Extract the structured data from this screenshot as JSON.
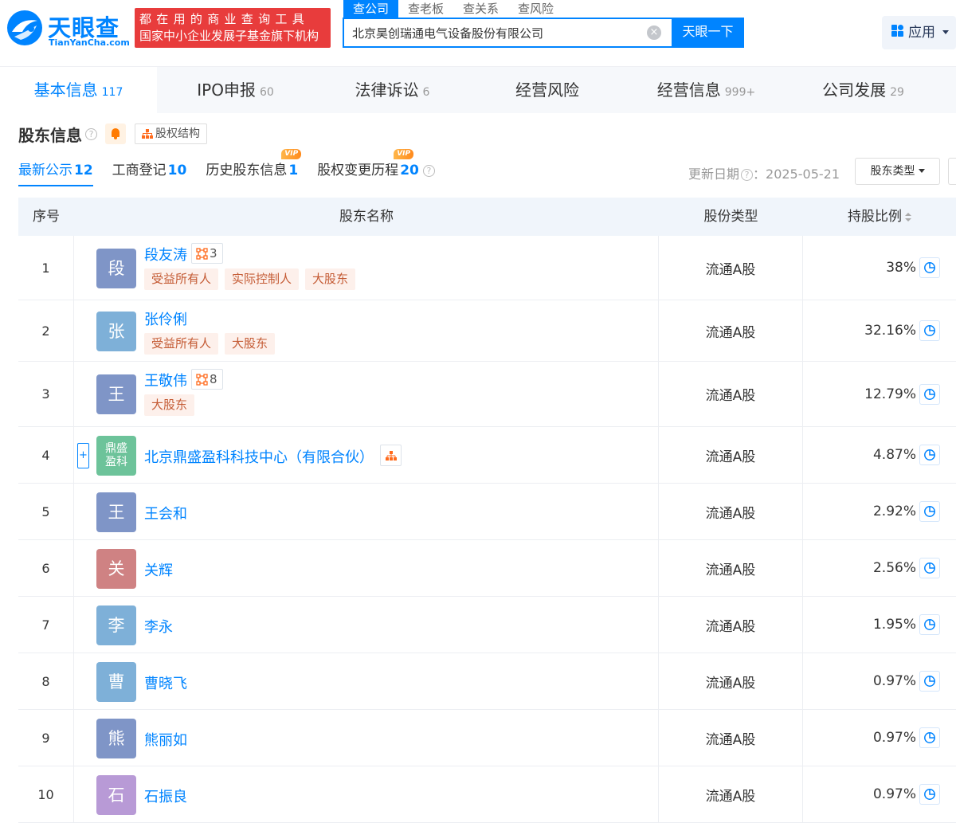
{
  "header": {
    "logo_cn": "天眼查",
    "logo_en": "TianYanCha.com",
    "slogan_line1": "都在用的商业查询工具",
    "slogan_line2": "国家中小企业发展子基金旗下机构",
    "search_tabs": [
      "查公司",
      "查老板",
      "查关系",
      "查风险"
    ],
    "search_value": "北京昊创瑞通电气设备股份有限公司",
    "search_button": "天眼一下",
    "apps_label": "应用"
  },
  "main_tabs": [
    {
      "label": "基本信息",
      "count": "117"
    },
    {
      "label": "IPO申报",
      "count": "60"
    },
    {
      "label": "法律诉讼",
      "count": "6"
    },
    {
      "label": "经营风险",
      "count": ""
    },
    {
      "label": "经营信息",
      "count": "999+"
    },
    {
      "label": "公司发展",
      "count": "29"
    }
  ],
  "section": {
    "title": "股东信息",
    "help": "?",
    "equity_button": "股权结构"
  },
  "sub_tabs": [
    {
      "label": "最新公示",
      "count": "12",
      "vip": ""
    },
    {
      "label": "工商登记",
      "count": "10",
      "vip": ""
    },
    {
      "label": "历史股东信息",
      "count": "1",
      "vip": "VIP"
    },
    {
      "label": "股权变更历程",
      "count": "20",
      "vip": "VIP"
    }
  ],
  "update_label": "更新日期",
  "update_date": "：2025-05-21",
  "type_dropdown": "股东类型",
  "table": {
    "headers": {
      "index": "序号",
      "name": "股东名称",
      "type": "股份类型",
      "ratio": "持股比例"
    },
    "rows": [
      {
        "index": "1",
        "avatar": "段",
        "avatar_color": "#7f95c7",
        "name": "段友涛",
        "rel_count": "3",
        "tags": [
          "受益所有人",
          "实际控制人",
          "大股东"
        ],
        "type": "流通A股",
        "ratio": "38%"
      },
      {
        "index": "2",
        "avatar": "张",
        "avatar_color": "#7eb0d8",
        "name": "张伶俐",
        "rel_count": "",
        "tags": [
          "受益所有人",
          "大股东"
        ],
        "type": "流通A股",
        "ratio": "32.16%"
      },
      {
        "index": "3",
        "avatar": "王",
        "avatar_color": "#7f95c7",
        "name": "王敬伟",
        "rel_count": "8",
        "tags": [
          "大股东"
        ],
        "type": "流通A股",
        "ratio": "12.79%"
      },
      {
        "index": "4",
        "avatar": "鼎盛盈科",
        "avatar_line1": "鼎盛",
        "avatar_line2": "盈科",
        "avatar_color": "#6dc39a",
        "name": "北京鼎盛盈科科技中心（有限合伙）",
        "expand": "+",
        "rel_count": "",
        "tags": [],
        "type": "流通A股",
        "ratio": "4.87%"
      },
      {
        "index": "5",
        "avatar": "王",
        "avatar_color": "#7f95c7",
        "name": "王会和",
        "rel_count": "",
        "tags": [],
        "type": "流通A股",
        "ratio": "2.92%"
      },
      {
        "index": "6",
        "avatar": "关",
        "avatar_color": "#cf8283",
        "name": "关辉",
        "rel_count": "",
        "tags": [],
        "type": "流通A股",
        "ratio": "2.56%"
      },
      {
        "index": "7",
        "avatar": "李",
        "avatar_color": "#7eb0d8",
        "name": "李永",
        "rel_count": "",
        "tags": [],
        "type": "流通A股",
        "ratio": "1.95%"
      },
      {
        "index": "8",
        "avatar": "曹",
        "avatar_color": "#7eb0d8",
        "name": "曹晓飞",
        "rel_count": "",
        "tags": [],
        "type": "流通A股",
        "ratio": "0.97%"
      },
      {
        "index": "9",
        "avatar": "熊",
        "avatar_color": "#7f95c7",
        "name": "熊丽如",
        "rel_count": "",
        "tags": [],
        "type": "流通A股",
        "ratio": "0.97%"
      },
      {
        "index": "10",
        "avatar": "石",
        "avatar_color": "#b89ad6",
        "name": "石振良",
        "rel_count": "",
        "tags": [],
        "type": "流通A股",
        "ratio": "0.97%"
      }
    ]
  },
  "colors": {
    "brand": "#0084ff",
    "slogan_bg": "#e83c3c",
    "tag_bg": "#fdf0eb",
    "tag_text": "#c45a33",
    "vip": "#ff8a1c"
  }
}
